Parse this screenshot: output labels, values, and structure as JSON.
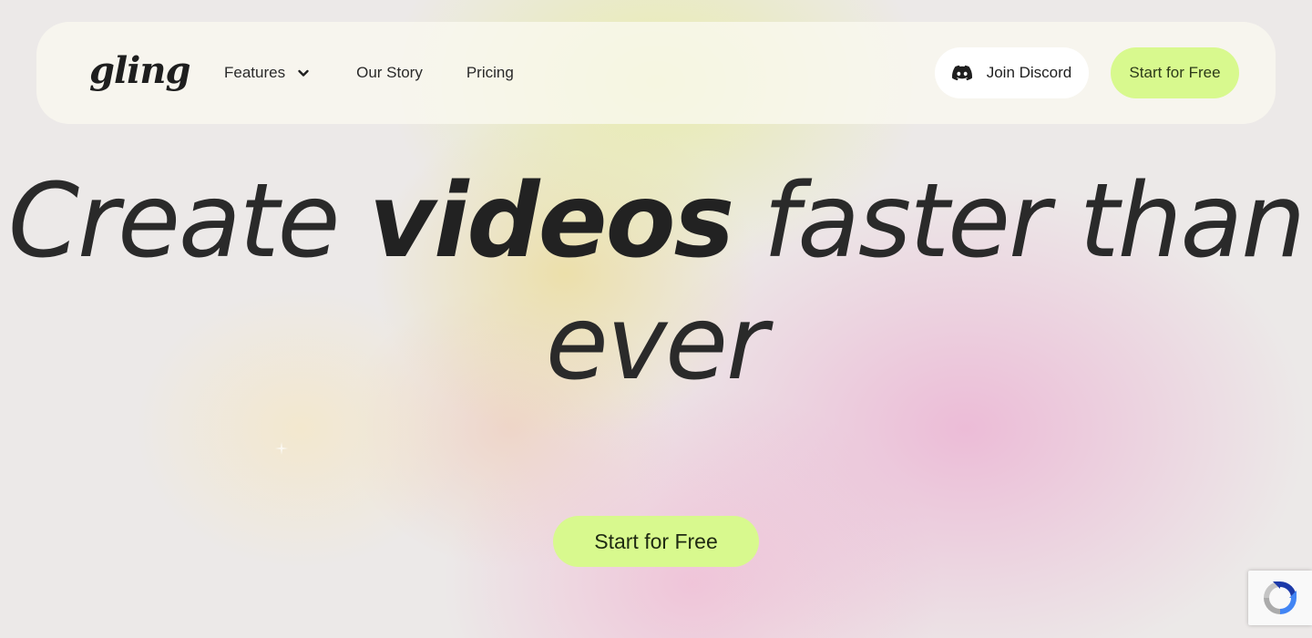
{
  "nav": {
    "logo_text": "gling",
    "links": [
      {
        "label": "Features",
        "has_dropdown": true
      },
      {
        "label": "Our Story"
      },
      {
        "label": "Pricing"
      }
    ],
    "discord_label": "Join Discord",
    "start_label": "Start for Free"
  },
  "hero": {
    "title_part1": "Create ",
    "title_bold": "videos",
    "title_part2": " faster than ever",
    "cta_label": "Start for Free"
  },
  "icons": {
    "discord": "discord-icon",
    "dropdown": "chevron-down-icon",
    "recaptcha": "recaptcha-icon"
  },
  "colors": {
    "accent_green": "#d8f98e",
    "text_dark": "#2a2a2a",
    "nav_bg": "#faf9f0"
  }
}
